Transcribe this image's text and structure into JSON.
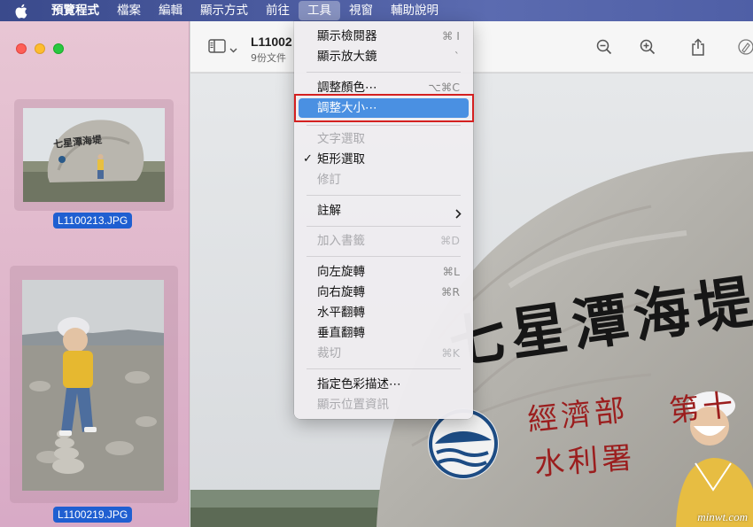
{
  "menubar": {
    "app_menu": "預覽程式",
    "items": [
      "檔案",
      "編輯",
      "顯示方式",
      "前往",
      "工具",
      "視窗",
      "輔助說明"
    ],
    "active_index": 4
  },
  "sidebar": {
    "thumbnails": [
      {
        "label": "L1100213.JPG",
        "stone_text": "七星潭海堤"
      },
      {
        "label": "L1100219.JPG"
      }
    ]
  },
  "toolbar": {
    "title": "L11002",
    "subtitle": "9份文件",
    "icons": [
      "sidebar-icon",
      "chevron-down-icon",
      "zoom-out-icon",
      "zoom-in-icon",
      "share-icon",
      "markup-icon"
    ]
  },
  "main": {
    "stone_text": "七星潭海堤",
    "sub_text_1": "經濟部",
    "sub_text_1b": "第十",
    "sub_text_2": "水利署"
  },
  "dropdown": {
    "items": [
      {
        "label": "顯示檢閱器",
        "shortcut": "⌘ I",
        "enabled": true
      },
      {
        "label": "顯示放大鏡",
        "shortcut": "`",
        "enabled": true
      },
      {
        "label": "調整顏色⋯",
        "shortcut": "⌥⌘C",
        "enabled": true
      },
      {
        "label": "調整大小⋯",
        "shortcut": "",
        "enabled": true,
        "highlighted": true
      },
      {
        "label": "文字選取",
        "shortcut": "",
        "enabled": false
      },
      {
        "label": "矩形選取",
        "shortcut": "",
        "enabled": true,
        "checked": true
      },
      {
        "label": "修訂",
        "shortcut": "",
        "enabled": false
      },
      {
        "label": "註解",
        "shortcut": "",
        "enabled": true,
        "submenu": true
      },
      {
        "label": "加入書籤",
        "shortcut": "⌘D",
        "enabled": false
      },
      {
        "label": "向左旋轉",
        "shortcut": "⌘L",
        "enabled": true
      },
      {
        "label": "向右旋轉",
        "shortcut": "⌘R",
        "enabled": true
      },
      {
        "label": "水平翻轉",
        "shortcut": "",
        "enabled": true
      },
      {
        "label": "垂直翻轉",
        "shortcut": "",
        "enabled": true
      },
      {
        "label": "裁切",
        "shortcut": "⌘K",
        "enabled": false
      },
      {
        "label": "指定色彩描述⋯",
        "shortcut": "",
        "enabled": true
      },
      {
        "label": "顯示位置資訊",
        "shortcut": "",
        "enabled": false
      }
    ]
  },
  "watermark": "minwt.com",
  "colors": {
    "highlight": "#4a90e2",
    "annotation_frame": "#d42020",
    "selection": "#1f5fd1"
  }
}
